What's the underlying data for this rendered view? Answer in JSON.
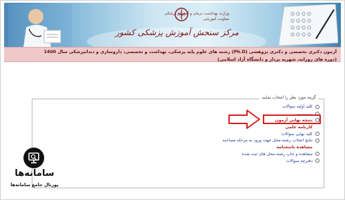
{
  "header": {
    "ministry_text": "وزارت بهداشت، درمان و آموزش پزشکی\nمعاونت آموزشی",
    "center_title": "مرکز سنجش آموزش پزشکی کشور"
  },
  "title_bar": {
    "line1": "آزمون دکتری تخصصی و دکتری پژوهشی (Ph.D) رشته های علوم پایه پزشکی، بهداشت و تخصصی، داروسازی و دندانپزشکی سال 1400",
    "line2": "(دوره های روزانه، شهریه پرداز و دانشگاه آزاد اسلامی)"
  },
  "panel": {
    "legend": "گزینه مورد نظر را انتخاب نمایید",
    "options": [
      {
        "label": "کلید اولیه سوالات",
        "radio": true,
        "red": false
      },
      {
        "label": "ـــــــــــــ",
        "radio": true,
        "red": false
      },
      {
        "label": "نتیجه نهایی آزمون",
        "radio": true,
        "red": true
      },
      {
        "label": "کارنامه علمی",
        "radio": false,
        "red": true
      },
      {
        "label": "کلید نهایی سوالات",
        "radio": true,
        "red": false
      },
      {
        "label": "نتایج انتخاب رشته-محل جهت ورود به مرحله مصاحبه",
        "radio": true,
        "red": false
      },
      {
        "label": "مشاهده باسخنامه",
        "radio": false,
        "red": true
      },
      {
        "label": "مشاهده و چاپ رشته-محل های ثبت شده",
        "radio": true,
        "red": false
      },
      {
        "label": "دفترچه سوالات",
        "radio": true,
        "red": false
      }
    ]
  },
  "watermark": {
    "brand": "سامانه‌ها",
    "tagline": "پورتال جامع سامانه‌ها"
  },
  "colors": {
    "title_bar_bg": "#efc8c8",
    "link_blue": "#1a3a8a",
    "highlight_red": "#d42020"
  }
}
